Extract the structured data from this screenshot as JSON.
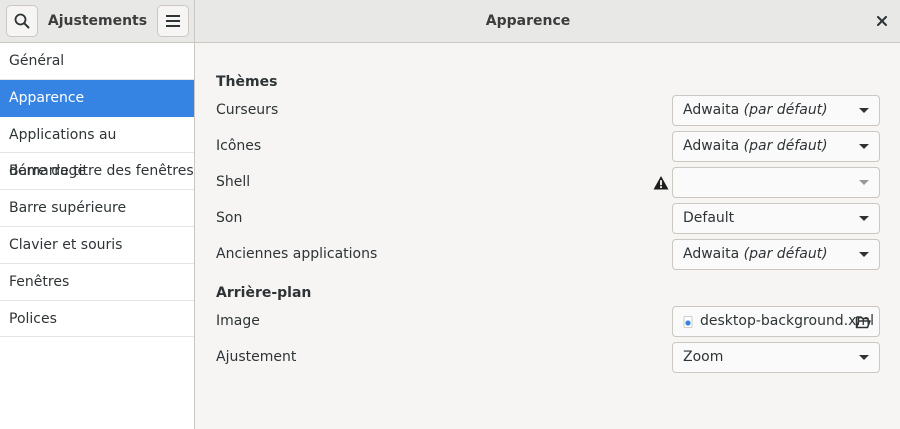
{
  "header": {
    "app_title": "Ajustements",
    "panel_title": "Apparence"
  },
  "sidebar": {
    "items": [
      {
        "label": "Général"
      },
      {
        "label": "Apparence"
      },
      {
        "label": "Applications au démarrage"
      },
      {
        "label": "Barre de titre des fenêtres"
      },
      {
        "label": "Barre supérieure"
      },
      {
        "label": "Clavier et souris"
      },
      {
        "label": "Fenêtres"
      },
      {
        "label": "Polices"
      }
    ],
    "active_index": 1
  },
  "themes": {
    "title": "Thèmes",
    "cursors": {
      "label": "Curseurs",
      "value": "Adwaita",
      "suffix": "(par défaut)"
    },
    "icons": {
      "label": "Icônes",
      "value": "Adwaita",
      "suffix": "(par défaut)"
    },
    "shell": {
      "label": "Shell",
      "value": "",
      "warning_icon": "warning-icon"
    },
    "sound": {
      "label": "Son",
      "value": "Default"
    },
    "legacy": {
      "label": "Anciennes applications",
      "value": "Adwaita",
      "suffix": "(par défaut)"
    }
  },
  "background": {
    "title": "Arrière-plan",
    "image": {
      "label": "Image",
      "file": "desktop-background.xml"
    },
    "adjustment": {
      "label": "Ajustement",
      "value": "Zoom"
    }
  },
  "colors": {
    "accent": "#3584e4",
    "headerbar": "#e8e8e7",
    "window_bg": "#f6f5f4"
  }
}
